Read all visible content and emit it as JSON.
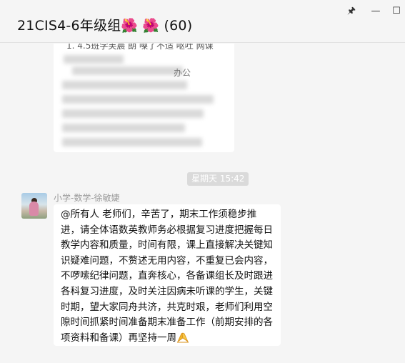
{
  "window": {
    "title": "21CIS4-6年级组🌺 🌺 (60)",
    "controls": {
      "pin": "🖈",
      "minimize": "—",
      "maximize": "☐"
    }
  },
  "messages": [
    {
      "type": "image",
      "visible_text": "1. 4.5班学芙晨 朗 嗓了不适 呕吐 网课",
      "partial_text": "办公"
    },
    {
      "type": "timestamp",
      "text": "星期天 15:42"
    },
    {
      "type": "text",
      "sender": "小学-数学-徐敏婕",
      "text": "@所有人 老师们，辛苦了，期末工作须稳步推进，请全体语数英教师务必根据复习进度把握每日教学内容和质量，时间有限，课上直接解决关键知识疑难问题，不赘述无用内容，不重复已会内容，不啰嗦纪律问题，直奔核心，各备课组长及时跟进各科复习进度，及时关注因病未听课的学生，关键时期，望大家同舟共济，共克时艰，老师们利用空隙时间抓紧时间准备期末准备工作（前期安排的各项资料和备课）再坚持一周",
      "emoji": "praying-hands"
    }
  ]
}
